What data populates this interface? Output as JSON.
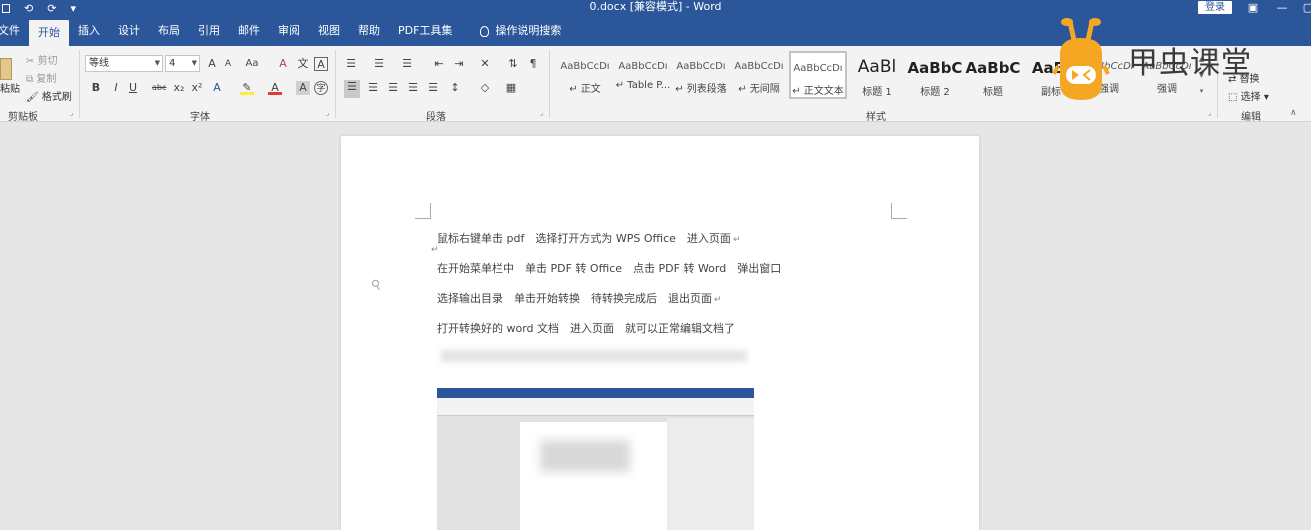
{
  "titlebar": {
    "title": "0.docx [兼容模式] - Word",
    "login": "登录",
    "qat": [
      "⟲",
      "⟳",
      "▾"
    ]
  },
  "tabs": [
    "文件",
    "开始",
    "插入",
    "设计",
    "布局",
    "引用",
    "邮件",
    "审阅",
    "视图",
    "帮助",
    "PDF工具集"
  ],
  "active_tab": "开始",
  "tellme": "操作说明搜索",
  "clipboard": {
    "paste": "粘贴",
    "cut": "剪切",
    "copy": "复制",
    "format_painter": "格式刷",
    "group": "剪贴板"
  },
  "font": {
    "name": "等线",
    "size": "4",
    "group": "字体"
  },
  "paragraph": {
    "group": "段落"
  },
  "styles": {
    "group": "样式",
    "items": [
      {
        "sample": "AaBbCcDı",
        "name": "↵ 正文"
      },
      {
        "sample": "AaBbCcDı",
        "name": "↵ Table P..."
      },
      {
        "sample": "AaBbCcDı",
        "name": "↵ 列表段落"
      },
      {
        "sample": "AaBbCcDı",
        "name": "↵ 无间隔"
      },
      {
        "sample": "AaBbCcDı",
        "name": "↵ 正文文本"
      },
      {
        "sample": "AaBl",
        "name": "标题 1"
      },
      {
        "sample": "AaBbC",
        "name": "标题 2"
      },
      {
        "sample": "AaBbC",
        "name": "标题"
      },
      {
        "sample": "AaBl",
        "name": "副标"
      },
      {
        "sample": "AaBbCcDı",
        "name": "强调"
      },
      {
        "sample": "AaBbCcDı",
        "name": "强调"
      }
    ]
  },
  "editing": {
    "replace": "替换",
    "select": "选择",
    "group": "编辑"
  },
  "document": {
    "lines": [
      "鼠标右键单击 pdf　选择打开方式为 WPS Office　进入页面",
      "在开始菜单栏中　单击 PDF 转 Office　点击 PDF 转 Word　弹出窗口",
      "选择输出目录　单击开始转换　待转换完成后　退出页面",
      "打开转换好的 word 文档　进入页面　就可以正常编辑文档了"
    ],
    "line_marks": [
      "↵",
      "",
      "↵",
      ""
    ]
  },
  "watermark": {
    "text": "甲虫课堂",
    "brand_color": "#f5a623"
  },
  "colors": {
    "accent": "#2b579a",
    "ribbon": "#f3f3f3",
    "canvas": "#e6e6e6"
  }
}
